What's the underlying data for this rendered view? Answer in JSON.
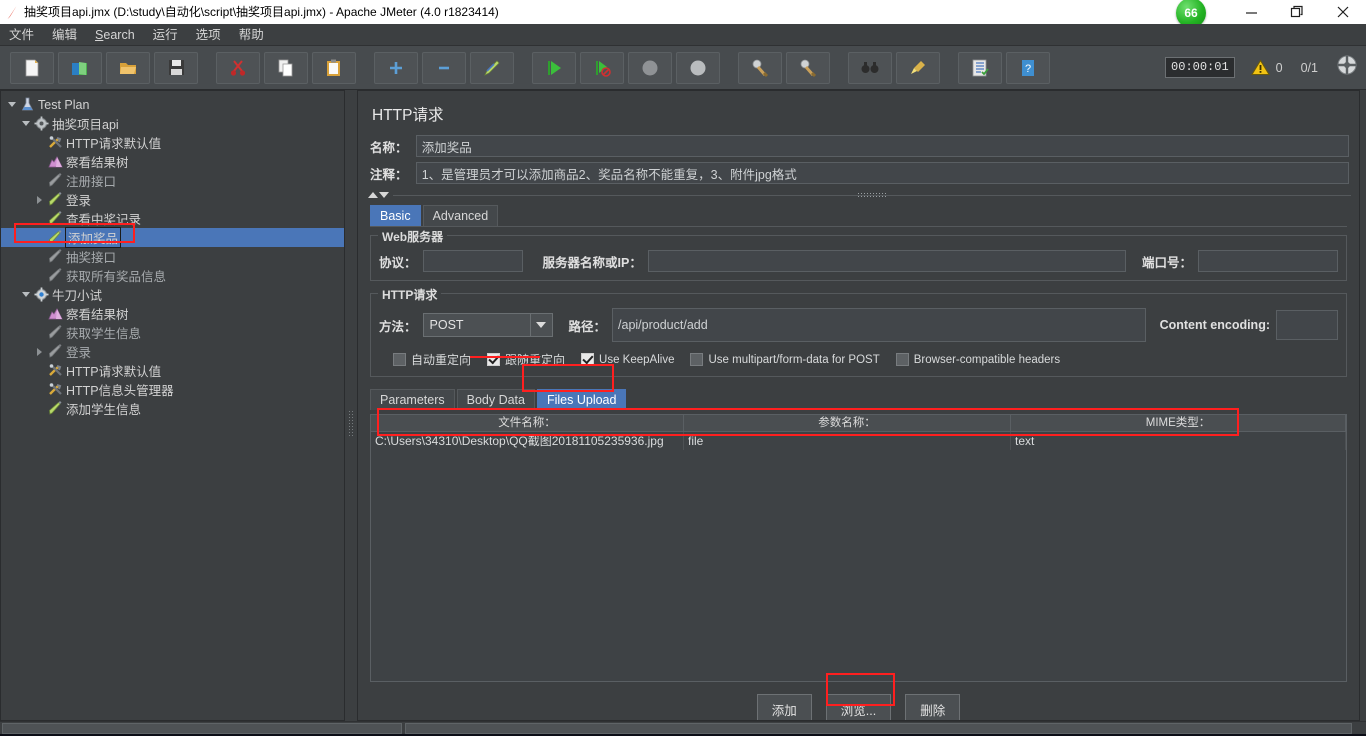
{
  "window": {
    "title": "抽奖项目api.jmx (D:\\study\\自动化\\script\\抽奖项目api.jmx) - Apache JMeter (4.0 r1823414)",
    "app_icon": "jmeter-feather-icon",
    "badge_count": "66",
    "minimize_label": "—",
    "maximize_label": "▫",
    "close_label": "✕"
  },
  "menubar": {
    "items": [
      {
        "label": "文件"
      },
      {
        "label": "编辑"
      },
      {
        "label": "Search",
        "mnemonic": "S"
      },
      {
        "label": "运行"
      },
      {
        "label": "选项"
      },
      {
        "label": "帮助"
      }
    ]
  },
  "toolbar": {
    "buttons": [
      {
        "name": "new-button",
        "icon": "new-document-icon"
      },
      {
        "name": "templates-button",
        "icon": "templates-icon"
      },
      {
        "name": "open-button",
        "icon": "open-folder-icon"
      },
      {
        "name": "save-button",
        "icon": "save-disk-icon"
      },
      {
        "name": "cut-button",
        "icon": "scissors-icon"
      },
      {
        "name": "copy-button",
        "icon": "copy-pages-icon"
      },
      {
        "name": "paste-button",
        "icon": "clipboard-icon"
      },
      {
        "name": "expand-all-button",
        "icon": "plus-icon"
      },
      {
        "name": "collapse-all-button",
        "icon": "minus-icon"
      },
      {
        "name": "toggle-button",
        "icon": "toggle-pencil-icon"
      },
      {
        "name": "start-button",
        "icon": "play-green-icon"
      },
      {
        "name": "start-no-pauses-button",
        "icon": "play-no-pause-icon"
      },
      {
        "name": "stop-button",
        "icon": "stop-icon"
      },
      {
        "name": "shutdown-button",
        "icon": "shutdown-icon"
      },
      {
        "name": "clear-button",
        "icon": "clear-broom-icon"
      },
      {
        "name": "clear-all-button",
        "icon": "clear-all-broom-icon"
      },
      {
        "name": "search-button",
        "icon": "binoculars-icon"
      },
      {
        "name": "reset-search-button",
        "icon": "reset-search-icon"
      },
      {
        "name": "function-helper-button",
        "icon": "function-helper-icon"
      },
      {
        "name": "help-button",
        "icon": "help-question-icon"
      }
    ],
    "timer": "00:00:01",
    "warning_icon": "warning-triangle-icon",
    "warning_count": "0",
    "threads_status": "0/1",
    "globe_icon": "remote-globe-icon"
  },
  "tree": {
    "nodes": [
      {
        "label": "Test Plan",
        "indent": 0,
        "toggle": "down",
        "icon": "test-plan-icon",
        "dim": false,
        "selected": false
      },
      {
        "label": "抽奖项目api",
        "indent": 1,
        "toggle": "down",
        "icon": "thread-group-icon",
        "dim": false,
        "selected": false
      },
      {
        "label": "HTTP请求默认值",
        "indent": 2,
        "toggle": "none",
        "icon": "config-tools-icon",
        "dim": false,
        "selected": false
      },
      {
        "label": "察看结果树",
        "indent": 2,
        "toggle": "none",
        "icon": "listener-chart-icon",
        "dim": false,
        "selected": false
      },
      {
        "label": "注册接口",
        "indent": 2,
        "toggle": "none",
        "icon": "http-sampler-disabled-icon",
        "dim": true,
        "selected": false
      },
      {
        "label": "登录",
        "indent": 2,
        "toggle": "right",
        "icon": "http-sampler-icon",
        "dim": false,
        "selected": false
      },
      {
        "label": "查看中奖记录",
        "indent": 2,
        "toggle": "none",
        "icon": "http-sampler-icon",
        "dim": false,
        "selected": false
      },
      {
        "label": "添加奖品",
        "indent": 2,
        "toggle": "none",
        "icon": "http-sampler-icon",
        "dim": false,
        "selected": true,
        "editing": true
      },
      {
        "label": "抽奖接口",
        "indent": 2,
        "toggle": "none",
        "icon": "http-sampler-disabled-icon",
        "dim": true,
        "selected": false
      },
      {
        "label": "获取所有奖品信息",
        "indent": 2,
        "toggle": "none",
        "icon": "http-sampler-disabled-icon",
        "dim": true,
        "selected": false
      },
      {
        "label": "牛刀小试",
        "indent": 1,
        "toggle": "down",
        "icon": "thread-group-blue-icon",
        "dim": false,
        "selected": false
      },
      {
        "label": "察看结果树",
        "indent": 2,
        "toggle": "none",
        "icon": "listener-chart-icon",
        "dim": false,
        "selected": false
      },
      {
        "label": "获取学生信息",
        "indent": 2,
        "toggle": "none",
        "icon": "http-sampler-disabled-icon",
        "dim": true,
        "selected": false
      },
      {
        "label": "登录",
        "indent": 2,
        "toggle": "right",
        "icon": "http-sampler-disabled-icon",
        "dim": true,
        "selected": false
      },
      {
        "label": "HTTP请求默认值",
        "indent": 2,
        "toggle": "none",
        "icon": "config-tools-icon",
        "dim": false,
        "selected": false
      },
      {
        "label": "HTTP信息头管理器",
        "indent": 2,
        "toggle": "none",
        "icon": "config-tools-icon",
        "dim": false,
        "selected": false
      },
      {
        "label": "添加学生信息",
        "indent": 2,
        "toggle": "none",
        "icon": "http-sampler-icon",
        "dim": false,
        "selected": false
      }
    ]
  },
  "panel": {
    "title": "HTTP请求",
    "name_label": "名称：",
    "name_value": "添加奖品",
    "comment_label": "注释：",
    "comment_value": "1、是管理员才可以添加商品2、奖品名称不能重复，3、附件jpg格式",
    "tabs": [
      {
        "label": "Basic",
        "active": true
      },
      {
        "label": "Advanced",
        "active": false
      }
    ],
    "webserver": {
      "title": "Web服务器",
      "protocol_label": "协议：",
      "protocol_value": "",
      "server_label": "服务器名称或IP：",
      "server_value": "",
      "port_label": "端口号：",
      "port_value": ""
    },
    "httprequest": {
      "title": "HTTP请求",
      "method_label": "方法：",
      "method_value": "POST",
      "path_label": "路径：",
      "path_value": "/api/product/add",
      "encoding_label": "Content encoding:",
      "encoding_value": ""
    },
    "checkboxes": [
      {
        "label": "自动重定向",
        "checked": false,
        "cn": true
      },
      {
        "label": "跟随重定向",
        "checked": true,
        "cn": true
      },
      {
        "label": "Use KeepAlive",
        "checked": true,
        "cn": false
      },
      {
        "label": "Use multipart/form-data for POST",
        "checked": false,
        "cn": false
      },
      {
        "label": "Browser-compatible headers",
        "checked": false,
        "cn": false
      }
    ],
    "datatabs": [
      {
        "label": "Parameters",
        "active": false
      },
      {
        "label": "Body Data",
        "active": false
      },
      {
        "label": "Files Upload",
        "active": true
      }
    ],
    "table": {
      "columns": [
        "文件名称：",
        "参数名称：",
        "MIME类型："
      ],
      "rows": [
        [
          "C:\\Users\\34310\\Desktop\\QQ截图20181105235936.jpg",
          "file",
          "text"
        ]
      ]
    },
    "buttons": [
      {
        "label": "添加",
        "name": "add-file-button",
        "highlighted": false
      },
      {
        "label": "浏览...",
        "name": "browse-file-button",
        "highlighted": true
      },
      {
        "label": "删除",
        "name": "delete-file-button",
        "highlighted": false
      }
    ]
  }
}
